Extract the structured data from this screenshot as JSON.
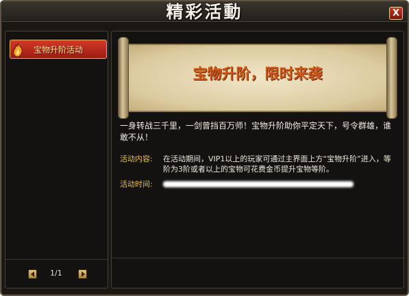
{
  "window": {
    "title": "精彩活動",
    "close_label": "X"
  },
  "sidebar": {
    "items": [
      {
        "label": "宝物升阶活动",
        "badge_icon": "flame-badge-icon",
        "selected": true
      }
    ],
    "pager": {
      "text": "1/1",
      "prev_icon": "arrow-left-icon",
      "next_icon": "arrow-right-icon"
    }
  },
  "banner": {
    "title": "宝物升阶，限时来袭"
  },
  "content": {
    "intro": "一身转战三千里，一剑曾挡百万师！宝物升阶助你平定天下，号令群雄，谁敢不从！",
    "activity_content_label": "活动内容:",
    "activity_content_value": "在活动期间，VIP1以上的玩家可通过主界面上方“宝物升阶”进入，等阶为3阶或者以上的宝物可花费金币提升宝物等阶。",
    "activity_time_label": "活动时间:"
  },
  "colors": {
    "accent_red": "#c62f22",
    "label_gold": "#e4c14a",
    "banner_orange": "#d2571c"
  }
}
